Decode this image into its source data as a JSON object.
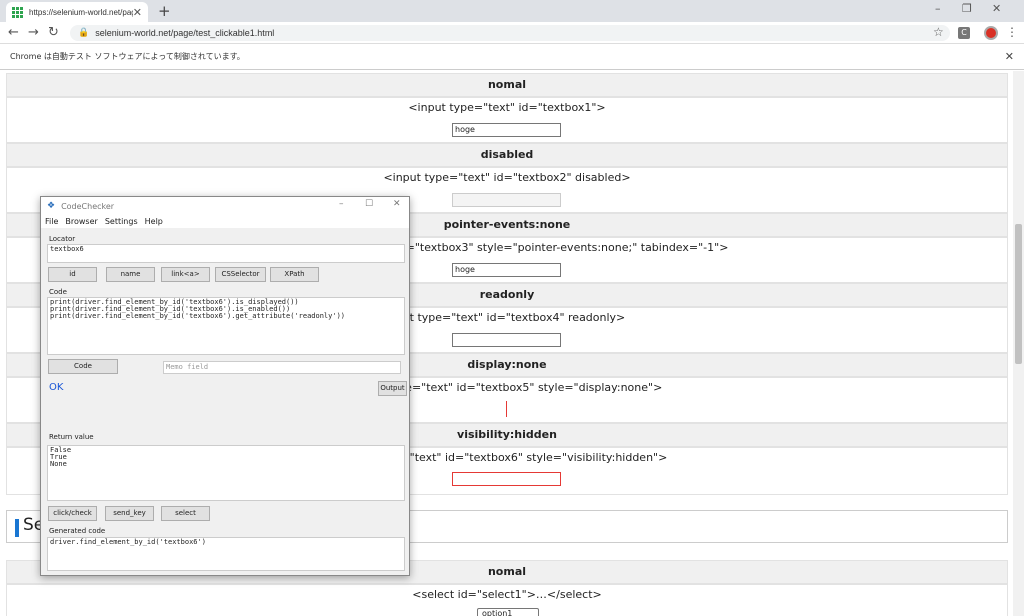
{
  "browser": {
    "tab_title": "https://selenium-world.net/page",
    "tab_close": "✕",
    "new_tab": "+",
    "url": "selenium-world.net/page/test_clickable1.html",
    "info_bar": "Chrome は自動テスト ソフトウェアによって制御されています。",
    "ext_label": "C"
  },
  "page": {
    "sections": [
      {
        "heading": "nomal",
        "desc": "<input type=\"text\" id=\"textbox1\">",
        "value": "hoge"
      },
      {
        "heading": "disabled",
        "desc": "<input type=\"text\" id=\"textbox2\" disabled>",
        "value": ""
      },
      {
        "heading": "pointer-events:none",
        "desc": "id=\"textbox3\" style=\"pointer-events:none;\" tabindex=\"-1\">",
        "value": "hoge"
      },
      {
        "heading": "readonly",
        "desc": "nput type=\"text\" id=\"textbox4\" readonly>",
        "value": ""
      },
      {
        "heading": "display:none",
        "desc": "ype=\"text\" id=\"textbox5\" style=\"display:none\">",
        "value": ""
      },
      {
        "heading": "visibility:hidden",
        "desc": "pe=\"text\" id=\"textbox6\" style=\"visibility:hidden\">",
        "value": ""
      }
    ],
    "select_section_title": "Se",
    "select_heading": "nomal",
    "select_desc": "<select id=\"select1\">…</select>",
    "select_value": "option1"
  },
  "codechecker": {
    "title": "CodeChecker",
    "menu": [
      "File",
      "Browser",
      "Settings",
      "Help"
    ],
    "locator_label": "Locator",
    "locator_value": "textbox6",
    "locator_buttons": [
      "id",
      "name",
      "link<a>",
      "CSSelector",
      "XPath"
    ],
    "code_label": "Code",
    "code_value": "print(driver.find_element_by_id('textbox6').is_displayed())\nprint(driver.find_element_by_id('textbox6').is_enabled())\nprint(driver.find_element_by_id('textbox6').get_attribute('readonly'))",
    "code_button": "Code",
    "memo_placeholder": "Memo field",
    "status": "OK",
    "output_button": "Output",
    "return_label": "Return value",
    "return_value": "False\nTrue\nNone",
    "action_buttons": [
      "click/check",
      "send_key",
      "select"
    ],
    "generated_label": "Generated code",
    "generated_value": "driver.find_element_by_id('textbox6')"
  }
}
